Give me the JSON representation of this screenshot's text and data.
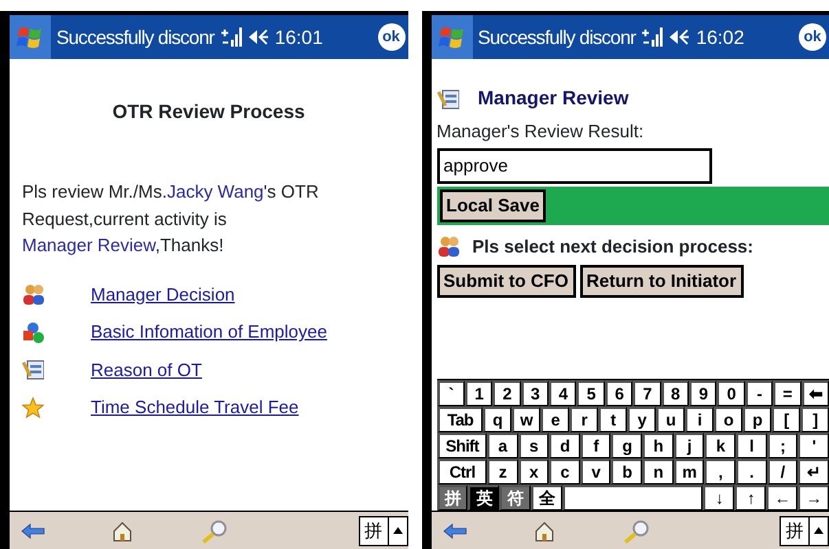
{
  "screens": [
    {
      "status_bar": {
        "title": "Successfully disconr",
        "time": "16:01",
        "ok": "ok"
      },
      "kind": "summary",
      "heading": "OTR Review Process",
      "message": [
        {
          "kind": "plain",
          "text": "Pls review Mr./Ms."
        },
        {
          "kind": "link",
          "text": "Jacky Wang"
        },
        {
          "kind": "plain",
          "text": "'s OTR Request,current activity is "
        },
        {
          "kind": "link",
          "text": "Manager Review"
        },
        {
          "kind": "plain",
          "text": ",Thanks!"
        }
      ],
      "links": [
        {
          "kind": "people",
          "label": "Manager Decision"
        },
        {
          "kind": "shapes",
          "label": "Basic Infomation of Employee"
        },
        {
          "kind": "form",
          "label": "Reason of OT"
        },
        {
          "kind": "star",
          "label": "Time Schedule Travel Fee"
        }
      ],
      "menu_bar": {
        "ime": "拼"
      }
    },
    {
      "status_bar": {
        "title": "Successfully disconr",
        "time": "16:02",
        "ok": "ok"
      },
      "kind": "review",
      "section_title": "Manager Review",
      "field_label": "Manager's Review Result:",
      "field_value": "approve",
      "save_button": "Local Save",
      "decision_prompt": "Pls select next decision process:",
      "decision_buttons": [
        "Submit to CFO",
        "Return to Initiator"
      ],
      "keyboard": [
        [
          {
            "kind": "key",
            "label": "`"
          },
          {
            "kind": "key",
            "label": "1"
          },
          {
            "kind": "key",
            "label": "2"
          },
          {
            "kind": "key",
            "label": "3"
          },
          {
            "kind": "key",
            "label": "4"
          },
          {
            "kind": "key",
            "label": "5"
          },
          {
            "kind": "key",
            "label": "6"
          },
          {
            "kind": "key",
            "label": "7"
          },
          {
            "kind": "key",
            "label": "8"
          },
          {
            "kind": "key",
            "label": "9"
          },
          {
            "kind": "key",
            "label": "0"
          },
          {
            "kind": "key",
            "label": "-"
          },
          {
            "kind": "key",
            "label": "="
          },
          {
            "kind": "key",
            "label": "⬅"
          }
        ],
        [
          {
            "kind": "wide",
            "label": "Tab"
          },
          {
            "kind": "key",
            "label": "q"
          },
          {
            "kind": "key",
            "label": "w"
          },
          {
            "kind": "key",
            "label": "e"
          },
          {
            "kind": "key",
            "label": "r"
          },
          {
            "kind": "key",
            "label": "t"
          },
          {
            "kind": "key",
            "label": "y"
          },
          {
            "kind": "key",
            "label": "u"
          },
          {
            "kind": "key",
            "label": "i"
          },
          {
            "kind": "key",
            "label": "o"
          },
          {
            "kind": "key",
            "label": "p"
          },
          {
            "kind": "key",
            "label": "["
          },
          {
            "kind": "key",
            "label": "]"
          }
        ],
        [
          {
            "kind": "wide",
            "label": "Shift"
          },
          {
            "kind": "key",
            "label": "a"
          },
          {
            "kind": "key",
            "label": "s"
          },
          {
            "kind": "key",
            "label": "d"
          },
          {
            "kind": "key",
            "label": "f"
          },
          {
            "kind": "key",
            "label": "g"
          },
          {
            "kind": "key",
            "label": "h"
          },
          {
            "kind": "key",
            "label": "j"
          },
          {
            "kind": "key",
            "label": "k"
          },
          {
            "kind": "key",
            "label": "l"
          },
          {
            "kind": "key",
            "label": ";"
          },
          {
            "kind": "key",
            "label": "'"
          }
        ],
        [
          {
            "kind": "wide",
            "label": "Ctrl"
          },
          {
            "kind": "key",
            "label": "z"
          },
          {
            "kind": "key",
            "label": "x"
          },
          {
            "kind": "key",
            "label": "c"
          },
          {
            "kind": "key",
            "label": "v"
          },
          {
            "kind": "key",
            "label": "b"
          },
          {
            "kind": "key",
            "label": "n"
          },
          {
            "kind": "key",
            "label": "m"
          },
          {
            "kind": "key",
            "label": ","
          },
          {
            "kind": "key",
            "label": "."
          },
          {
            "kind": "key",
            "label": "/"
          },
          {
            "kind": "key",
            "label": "↵"
          }
        ],
        [
          {
            "kind": "mode",
            "label": "拼",
            "selected": false
          },
          {
            "kind": "mode",
            "label": "英",
            "selected": true
          },
          {
            "kind": "mode",
            "label": "符",
            "selected": false
          },
          {
            "kind": "key",
            "label": "全"
          },
          {
            "kind": "space"
          },
          {
            "kind": "key",
            "label": "↓"
          },
          {
            "kind": "key",
            "label": "↑"
          },
          {
            "kind": "key",
            "label": "←"
          },
          {
            "kind": "key",
            "label": "→"
          }
        ]
      ],
      "menu_bar": {
        "ime": "拼"
      }
    }
  ]
}
